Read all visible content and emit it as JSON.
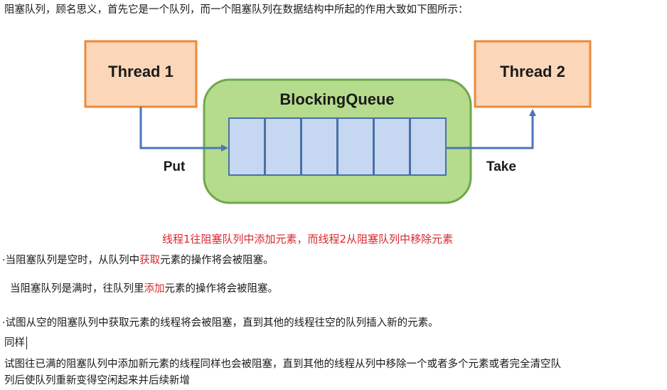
{
  "intro": "阻塞队列，顾名思义，首先它是一个队列，而一个阻塞队列在数据结构中所起的作用大致如下图所示：",
  "diagram": {
    "thread1": "Thread 1",
    "thread2": "Thread 2",
    "queue": "BlockingQueue",
    "put": "Put",
    "take": "Take",
    "colors": {
      "thread_fill": "#fbd6b8",
      "thread_border": "#ea8a3c",
      "queue_fill": "#b4dc8c",
      "queue_border": "#6fa84a",
      "cell_fill": "#c6d8f1",
      "cell_border": "#4a6fa8",
      "arrow": "#4b77b8"
    }
  },
  "caption": {
    "text": "线程1往阻塞队列中添加元素，而线程2从阻塞队列中移除元素"
  },
  "bullets": [
    {
      "bullet": "·",
      "pre": "当阻塞队列是空时，从队列中",
      "highlight": "获取",
      "post": "元素的操作将会被阻塞。"
    },
    {
      "bullet": "",
      "pre": "当阻塞队列是满时，往队列里",
      "highlight": "添加",
      "post": "元素的操作将会被阻塞。"
    },
    {
      "bullet": "·",
      "text": "试图从空的阻塞队列中获取元素的线程将会被阻塞，直到其他的线程往空的队列插入新的元素。"
    }
  ],
  "same": "同样",
  "para1": "试图往已满的阻塞队列中添加新元素的线程同样也会被阻塞，直到其他的线程从列中移除一个或者多个元素或者完全清空队",
  "para2": "列后使队列重新变得空闲起来并后续新增"
}
